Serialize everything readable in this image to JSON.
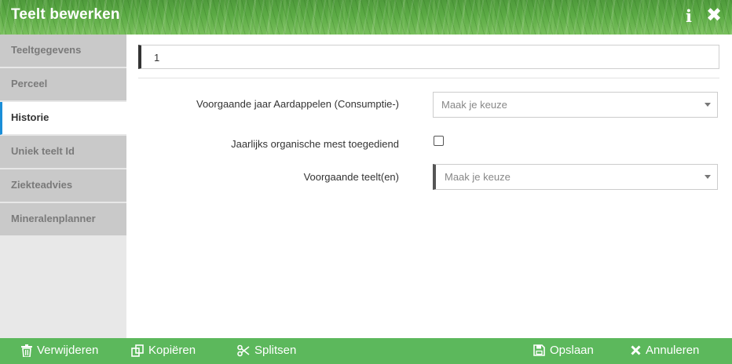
{
  "header": {
    "title": "Teelt bewerken",
    "info_glyph": "i",
    "close_glyph": "✖"
  },
  "sidebar": {
    "items": [
      {
        "label": "Teeltgegevens",
        "active": false
      },
      {
        "label": "Perceel",
        "active": false
      },
      {
        "label": "Historie",
        "active": true
      },
      {
        "label": "Uniek teelt Id",
        "active": false
      },
      {
        "label": "Ziekteadvies",
        "active": false
      },
      {
        "label": "Mineralenplanner",
        "active": false
      }
    ]
  },
  "form": {
    "first_field_value": "1",
    "previous_year_label": "Voorgaande jaar Aardappelen (Consumptie-)",
    "previous_year_placeholder": "Maak je keuze",
    "organic_manure_label": "Jaarlijks organische mest toegediend",
    "organic_manure_checked": false,
    "previous_crops_label": "Voorgaande teelt(en)",
    "previous_crops_placeholder": "Maak je keuze"
  },
  "footer": {
    "delete_label": "Verwijderen",
    "copy_label": "Kopiëren",
    "split_label": "Splitsen",
    "save_label": "Opslaan",
    "cancel_label": "Annuleren"
  },
  "icons": {
    "info": "info-icon",
    "close": "close-icon",
    "delete": "trash-icon",
    "copy": "copy-icon",
    "split": "scissors-icon",
    "save": "floppy-disk-icon",
    "cancel": "x-icon",
    "dropdown": "caret-down-icon"
  },
  "colors": {
    "header_green": "#5cab45",
    "footer_green": "#5cb85c",
    "active_accent": "#1a8ed8",
    "sidebar_inactive": "#c9c9c9"
  }
}
